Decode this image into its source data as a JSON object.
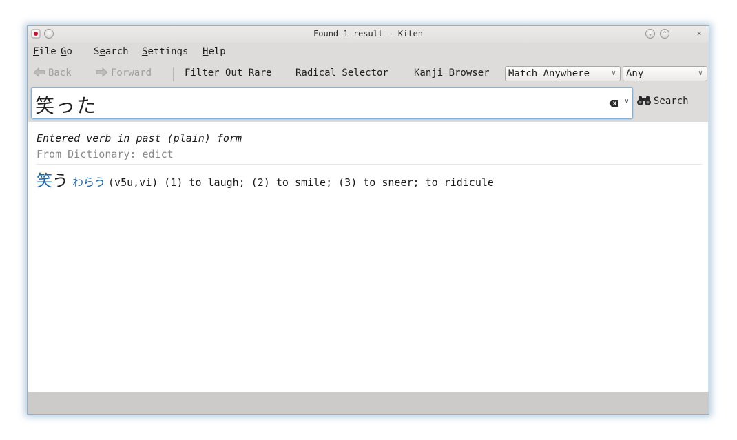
{
  "window": {
    "title": "Found 1 result - Kiten"
  },
  "menu": {
    "file": {
      "accel": "F",
      "rest": "ile"
    },
    "go": {
      "accel": "G",
      "rest": "o"
    },
    "search": {
      "pre": "S",
      "accel": "e",
      "rest": "arch"
    },
    "settings": {
      "accel": "S",
      "rest": "ettings"
    },
    "help": {
      "accel": "H",
      "rest": "elp"
    }
  },
  "toolbar": {
    "back": "Back",
    "forward": "Forward",
    "filter_rare": "Filter Out Rare",
    "radical_selector": "Radical Selector",
    "kanji_browser": "Kanji Browser",
    "match_mode": "Match Anywhere",
    "word_type": "Any"
  },
  "search": {
    "value": "笑った",
    "button": "Search"
  },
  "result": {
    "deinflection": "Entered verb in past (plain) form",
    "dictionary": "From Dictionary: edict",
    "word_kanji": "笑",
    "word_kana": "う",
    "reading": "わらう",
    "meaning": "(v5u,vi) (1) to laugh; (2) to smile; (3) to sneer; to ridicule"
  },
  "colors": {
    "link_blue": "#1b66b1",
    "focus_border": "#7fb3e0",
    "window_bg": "#dedcda"
  },
  "icons": [
    "app-icon",
    "shade-icon",
    "minimize-icon",
    "maximize-icon",
    "close-icon",
    "back-arrow-icon",
    "forward-arrow-icon",
    "chevron-down-icon",
    "clear-text-icon",
    "binoculars-icon"
  ]
}
